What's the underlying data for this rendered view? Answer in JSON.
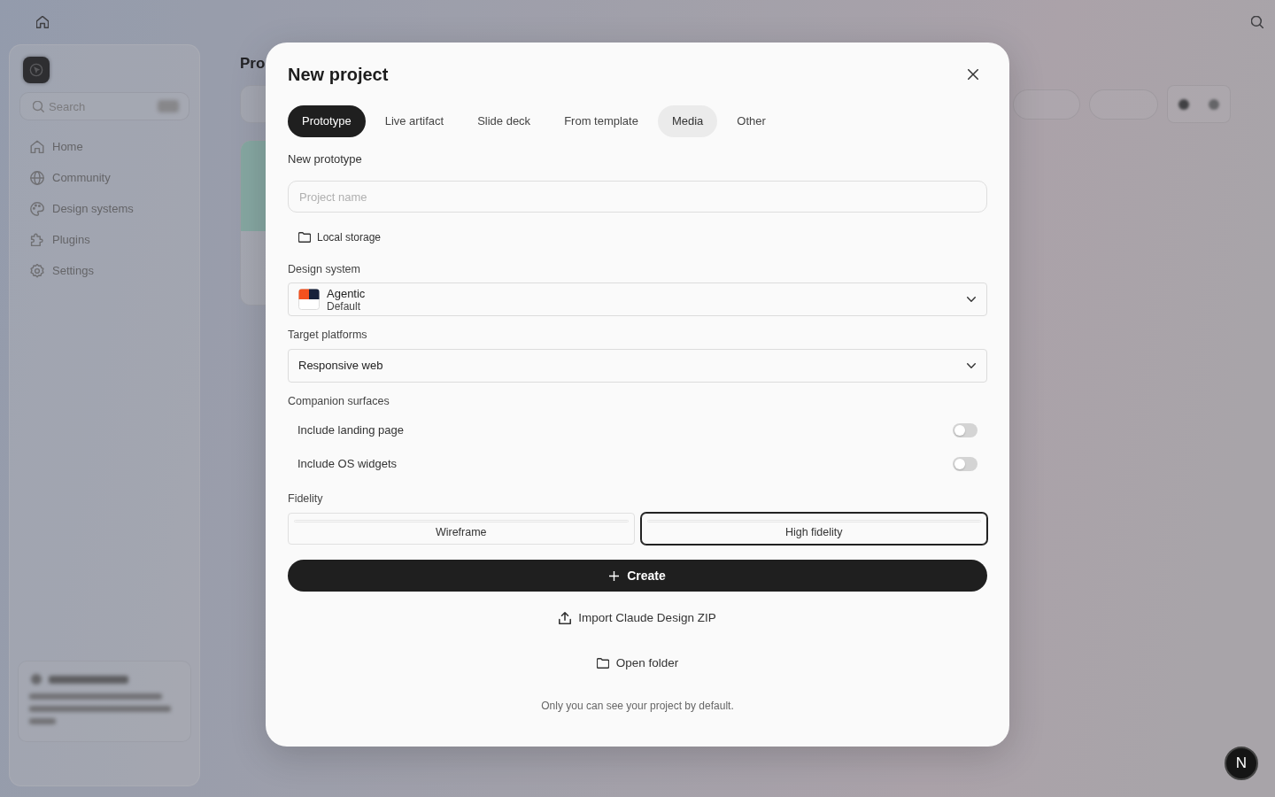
{
  "sidebar": {
    "search": {
      "placeholder": "Search"
    },
    "items": [
      {
        "label": "Home"
      },
      {
        "label": "Community"
      },
      {
        "label": "Design systems"
      },
      {
        "label": "Plugins"
      },
      {
        "label": "Settings"
      }
    ]
  },
  "main": {
    "title": "Pro"
  },
  "dialog": {
    "title": "New project",
    "tabs": [
      {
        "label": "Prototype",
        "selected": true,
        "hovered": false
      },
      {
        "label": "Live artifact",
        "selected": false,
        "hovered": false
      },
      {
        "label": "Slide deck",
        "selected": false,
        "hovered": false
      },
      {
        "label": "From template",
        "selected": false,
        "hovered": false
      },
      {
        "label": "Media",
        "selected": false,
        "hovered": true
      },
      {
        "label": "Other",
        "selected": false,
        "hovered": false
      }
    ],
    "heading": "New prototype",
    "project_name": {
      "placeholder": "Project name"
    },
    "storage": "Local storage",
    "design_system": {
      "label": "Design system",
      "name": "Agentic",
      "variant": "Default"
    },
    "target_platforms": {
      "label": "Target platforms",
      "value": "Responsive web"
    },
    "companion_surfaces": {
      "label": "Companion surfaces",
      "options": [
        {
          "label": "Include landing page",
          "on": false
        },
        {
          "label": "Include OS widgets",
          "on": false
        }
      ]
    },
    "fidelity": {
      "label": "Fidelity",
      "options": [
        {
          "label": "Wireframe",
          "selected": false
        },
        {
          "label": "High fidelity",
          "selected": true
        }
      ]
    },
    "create_button": "Create",
    "import_button": "Import Claude Design ZIP",
    "open_folder_button": "Open folder",
    "footnote": "Only you can see your project by default."
  },
  "dev_badge": {
    "label": "N"
  }
}
